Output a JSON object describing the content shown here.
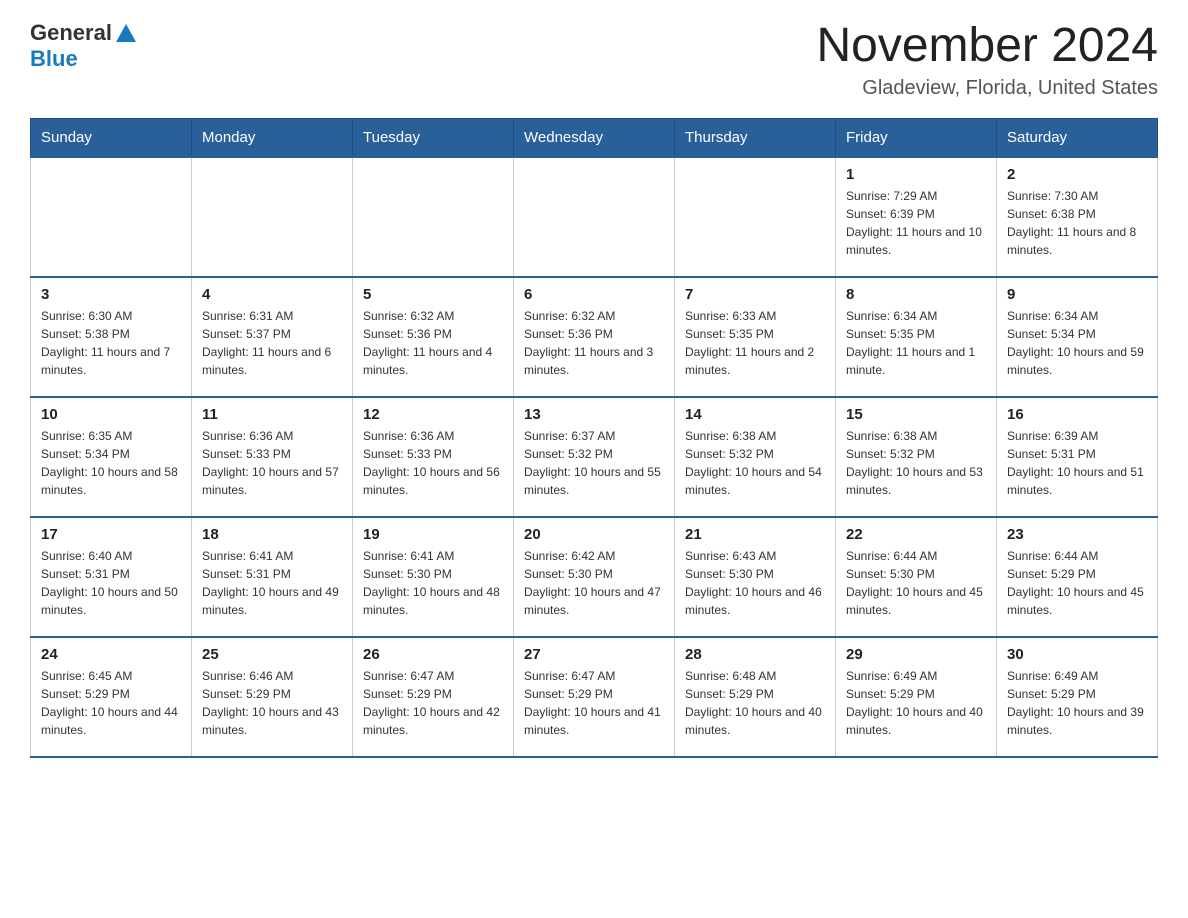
{
  "header": {
    "logo_general": "General",
    "logo_blue": "Blue",
    "month_title": "November 2024",
    "location": "Gladeview, Florida, United States"
  },
  "weekdays": [
    "Sunday",
    "Monday",
    "Tuesday",
    "Wednesday",
    "Thursday",
    "Friday",
    "Saturday"
  ],
  "weeks": [
    [
      {
        "day": "",
        "sunrise": "",
        "sunset": "",
        "daylight": ""
      },
      {
        "day": "",
        "sunrise": "",
        "sunset": "",
        "daylight": ""
      },
      {
        "day": "",
        "sunrise": "",
        "sunset": "",
        "daylight": ""
      },
      {
        "day": "",
        "sunrise": "",
        "sunset": "",
        "daylight": ""
      },
      {
        "day": "",
        "sunrise": "",
        "sunset": "",
        "daylight": ""
      },
      {
        "day": "1",
        "sunrise": "Sunrise: 7:29 AM",
        "sunset": "Sunset: 6:39 PM",
        "daylight": "Daylight: 11 hours and 10 minutes."
      },
      {
        "day": "2",
        "sunrise": "Sunrise: 7:30 AM",
        "sunset": "Sunset: 6:38 PM",
        "daylight": "Daylight: 11 hours and 8 minutes."
      }
    ],
    [
      {
        "day": "3",
        "sunrise": "Sunrise: 6:30 AM",
        "sunset": "Sunset: 5:38 PM",
        "daylight": "Daylight: 11 hours and 7 minutes."
      },
      {
        "day": "4",
        "sunrise": "Sunrise: 6:31 AM",
        "sunset": "Sunset: 5:37 PM",
        "daylight": "Daylight: 11 hours and 6 minutes."
      },
      {
        "day": "5",
        "sunrise": "Sunrise: 6:32 AM",
        "sunset": "Sunset: 5:36 PM",
        "daylight": "Daylight: 11 hours and 4 minutes."
      },
      {
        "day": "6",
        "sunrise": "Sunrise: 6:32 AM",
        "sunset": "Sunset: 5:36 PM",
        "daylight": "Daylight: 11 hours and 3 minutes."
      },
      {
        "day": "7",
        "sunrise": "Sunrise: 6:33 AM",
        "sunset": "Sunset: 5:35 PM",
        "daylight": "Daylight: 11 hours and 2 minutes."
      },
      {
        "day": "8",
        "sunrise": "Sunrise: 6:34 AM",
        "sunset": "Sunset: 5:35 PM",
        "daylight": "Daylight: 11 hours and 1 minute."
      },
      {
        "day": "9",
        "sunrise": "Sunrise: 6:34 AM",
        "sunset": "Sunset: 5:34 PM",
        "daylight": "Daylight: 10 hours and 59 minutes."
      }
    ],
    [
      {
        "day": "10",
        "sunrise": "Sunrise: 6:35 AM",
        "sunset": "Sunset: 5:34 PM",
        "daylight": "Daylight: 10 hours and 58 minutes."
      },
      {
        "day": "11",
        "sunrise": "Sunrise: 6:36 AM",
        "sunset": "Sunset: 5:33 PM",
        "daylight": "Daylight: 10 hours and 57 minutes."
      },
      {
        "day": "12",
        "sunrise": "Sunrise: 6:36 AM",
        "sunset": "Sunset: 5:33 PM",
        "daylight": "Daylight: 10 hours and 56 minutes."
      },
      {
        "day": "13",
        "sunrise": "Sunrise: 6:37 AM",
        "sunset": "Sunset: 5:32 PM",
        "daylight": "Daylight: 10 hours and 55 minutes."
      },
      {
        "day": "14",
        "sunrise": "Sunrise: 6:38 AM",
        "sunset": "Sunset: 5:32 PM",
        "daylight": "Daylight: 10 hours and 54 minutes."
      },
      {
        "day": "15",
        "sunrise": "Sunrise: 6:38 AM",
        "sunset": "Sunset: 5:32 PM",
        "daylight": "Daylight: 10 hours and 53 minutes."
      },
      {
        "day": "16",
        "sunrise": "Sunrise: 6:39 AM",
        "sunset": "Sunset: 5:31 PM",
        "daylight": "Daylight: 10 hours and 51 minutes."
      }
    ],
    [
      {
        "day": "17",
        "sunrise": "Sunrise: 6:40 AM",
        "sunset": "Sunset: 5:31 PM",
        "daylight": "Daylight: 10 hours and 50 minutes."
      },
      {
        "day": "18",
        "sunrise": "Sunrise: 6:41 AM",
        "sunset": "Sunset: 5:31 PM",
        "daylight": "Daylight: 10 hours and 49 minutes."
      },
      {
        "day": "19",
        "sunrise": "Sunrise: 6:41 AM",
        "sunset": "Sunset: 5:30 PM",
        "daylight": "Daylight: 10 hours and 48 minutes."
      },
      {
        "day": "20",
        "sunrise": "Sunrise: 6:42 AM",
        "sunset": "Sunset: 5:30 PM",
        "daylight": "Daylight: 10 hours and 47 minutes."
      },
      {
        "day": "21",
        "sunrise": "Sunrise: 6:43 AM",
        "sunset": "Sunset: 5:30 PM",
        "daylight": "Daylight: 10 hours and 46 minutes."
      },
      {
        "day": "22",
        "sunrise": "Sunrise: 6:44 AM",
        "sunset": "Sunset: 5:30 PM",
        "daylight": "Daylight: 10 hours and 45 minutes."
      },
      {
        "day": "23",
        "sunrise": "Sunrise: 6:44 AM",
        "sunset": "Sunset: 5:29 PM",
        "daylight": "Daylight: 10 hours and 45 minutes."
      }
    ],
    [
      {
        "day": "24",
        "sunrise": "Sunrise: 6:45 AM",
        "sunset": "Sunset: 5:29 PM",
        "daylight": "Daylight: 10 hours and 44 minutes."
      },
      {
        "day": "25",
        "sunrise": "Sunrise: 6:46 AM",
        "sunset": "Sunset: 5:29 PM",
        "daylight": "Daylight: 10 hours and 43 minutes."
      },
      {
        "day": "26",
        "sunrise": "Sunrise: 6:47 AM",
        "sunset": "Sunset: 5:29 PM",
        "daylight": "Daylight: 10 hours and 42 minutes."
      },
      {
        "day": "27",
        "sunrise": "Sunrise: 6:47 AM",
        "sunset": "Sunset: 5:29 PM",
        "daylight": "Daylight: 10 hours and 41 minutes."
      },
      {
        "day": "28",
        "sunrise": "Sunrise: 6:48 AM",
        "sunset": "Sunset: 5:29 PM",
        "daylight": "Daylight: 10 hours and 40 minutes."
      },
      {
        "day": "29",
        "sunrise": "Sunrise: 6:49 AM",
        "sunset": "Sunset: 5:29 PM",
        "daylight": "Daylight: 10 hours and 40 minutes."
      },
      {
        "day": "30",
        "sunrise": "Sunrise: 6:49 AM",
        "sunset": "Sunset: 5:29 PM",
        "daylight": "Daylight: 10 hours and 39 minutes."
      }
    ]
  ]
}
